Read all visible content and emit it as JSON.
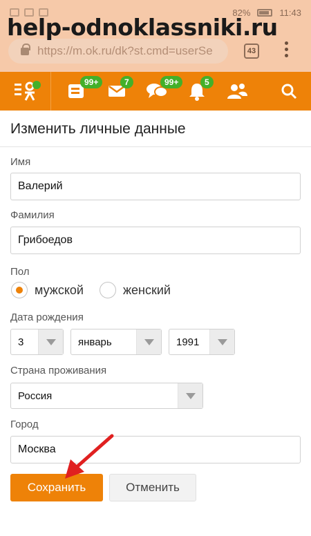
{
  "status_bar": {
    "battery": "82%",
    "time": "11:43"
  },
  "watermark": "help-odnoklassniki.ru",
  "browser": {
    "url": "https://m.ok.ru/dk?st.cmd=userSe",
    "tab_count": "43"
  },
  "nav": {
    "items": [
      {
        "name": "feed",
        "badge": "99+"
      },
      {
        "name": "messages",
        "badge": "7"
      },
      {
        "name": "discussions",
        "badge": "99+"
      },
      {
        "name": "notifications",
        "badge": "5"
      },
      {
        "name": "friends",
        "badge": ""
      }
    ]
  },
  "form": {
    "title": "Изменить личные данные",
    "first_name_label": "Имя",
    "first_name_value": "Валерий",
    "last_name_label": "Фамилия",
    "last_name_value": "Грибоедов",
    "gender_label": "Пол",
    "gender_male": "мужской",
    "gender_female": "женский",
    "birthdate_label": "Дата рождения",
    "birth_day": "3",
    "birth_month": "январь",
    "birth_year": "1991",
    "country_label": "Страна проживания",
    "country_value": "Россия",
    "city_label": "Город",
    "city_value": "Москва",
    "save_label": "Сохранить",
    "cancel_label": "Отменить"
  },
  "colors": {
    "accent": "#ee8208",
    "badge": "#43b02a",
    "annotation_arrow": "#e02020"
  }
}
